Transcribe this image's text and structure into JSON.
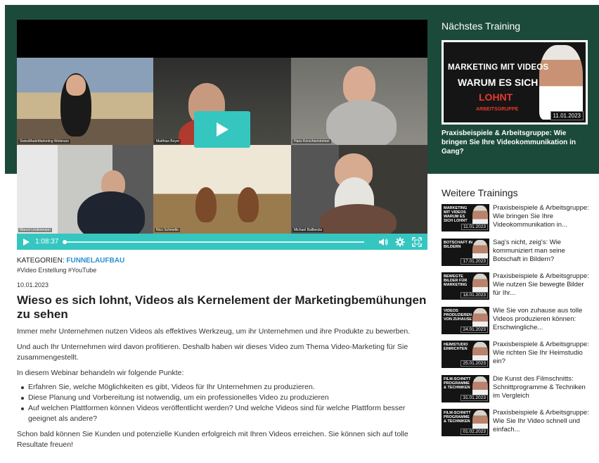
{
  "player": {
    "participants": [
      "SwissMadeMarketing Webinars",
      "Matthias Boyer",
      "Hans Kerschenstreiner",
      "Marcel Lindenmann",
      "Nico Schmelle",
      "Michael Ballbecke"
    ],
    "time": "1:08:37",
    "play_icon": "play-icon",
    "volume_icon": "volume-icon",
    "settings_icon": "gear-icon",
    "fullscreen_icon": "fullscreen-icon",
    "accent_color": "#35c6c0"
  },
  "article": {
    "category_label": "KATEGORIEN:",
    "category_link": "FUNNELAUFBAU",
    "tags": "#Video Erstellung #YouTube",
    "date": "10.01.2023",
    "title": "Wieso es sich lohnt, Videos als Kernelement der Marketingbemühungen zu sehen",
    "paragraphs": [
      "Immer mehr Unternehmen nutzen Videos als effektives Werkzeug, um ihr Unternehmen und ihre Produkte zu bewerben.",
      "Und auch Ihr Unternehmen wird davon profitieren. Deshalb haben wir dieses Video zum Thema Video-Marketing für Sie zusammengestellt.",
      "In diesem Webinar behandeln wir folgende Punkte:"
    ],
    "bullets": [
      "Erfahren Sie, welche Möglichkeiten es gibt, Videos für Ihr Unternehmen zu produzieren.",
      "Diese Planung und Vorbereitung ist notwendig, um ein professionelles Video zu produzieren",
      "Auf welchen Plattformen können Videos veröffentlicht werden? Und welche Videos sind für welche Plattform besser geeignet als andere?"
    ],
    "closing": "Schon bald können Sie Kunden und potenzielle Kunden erfolgreich mit Ihren Videos erreichen. Sie können sich auf tolle Resultate freuen!"
  },
  "next_training": {
    "heading": "Nächstes Training",
    "thumb_line1": "MARKETING MIT VIDEOS",
    "thumb_line2": "WARUM ES SICH",
    "thumb_line3": "LOHNT",
    "thumb_line4": "ARBEITSGRUPPE",
    "thumb_date": "11.01.2023",
    "title": "Praxisbeispiele & Arbeitsgruppe: Wie bringen Sie Ihre Videokommunikation in Gang?"
  },
  "more_trainings": {
    "heading": "Weitere Trainings",
    "items": [
      {
        "thumb_text": "MARKETING MIT VIDEOS WARUM ES SICH LOHNT",
        "date": "11.01.2023",
        "title": "Praxisbeispiele & Arbeitsgruppe: Wie bringen Sie Ihre Videokommunikation in..."
      },
      {
        "thumb_text": "BOTSCHAFT IN BILDERN",
        "date": "17.01.2023",
        "title": "Sag's nicht, zeig's: Wie kommuniziert man seine Botschaft in Bildern?"
      },
      {
        "thumb_text": "BEWEGTE BILDER FÜR MARKETING",
        "date": "18.01.2023",
        "title": "Praxisbeispiele & Arbeitsgruppe: Wie nutzen Sie bewegte Bilder für Ihr..."
      },
      {
        "thumb_text": "VIDEOS PRODUZIEREN VON ZUHAUSE",
        "date": "24.01.2023",
        "title": "Wie Sie von zuhause aus tolle Videos produzieren können: Erschwingliche..."
      },
      {
        "thumb_text": "HEIMSTUDIO EINRICHTEN",
        "date": "25.01.2023",
        "title": "Praxisbeispiele & Arbeitsgruppe: Wie richten Sie Ihr Heimstudio ein?"
      },
      {
        "thumb_text": "FILM-SCHNITT PROGRAMME & TECHNIKEN",
        "date": "31.01.2023",
        "title": "Die Kunst des Filmschnitts: Schnittprogramme & Techniken im Vergleich"
      },
      {
        "thumb_text": "FILM-SCHNITT PROGRAMME & TECHNIKEN",
        "date": "01.02.2023",
        "title": "Praxisbeispiele & Arbeitsgruppe: Wie Sie Ihr Video schnell und einfach..."
      }
    ]
  }
}
